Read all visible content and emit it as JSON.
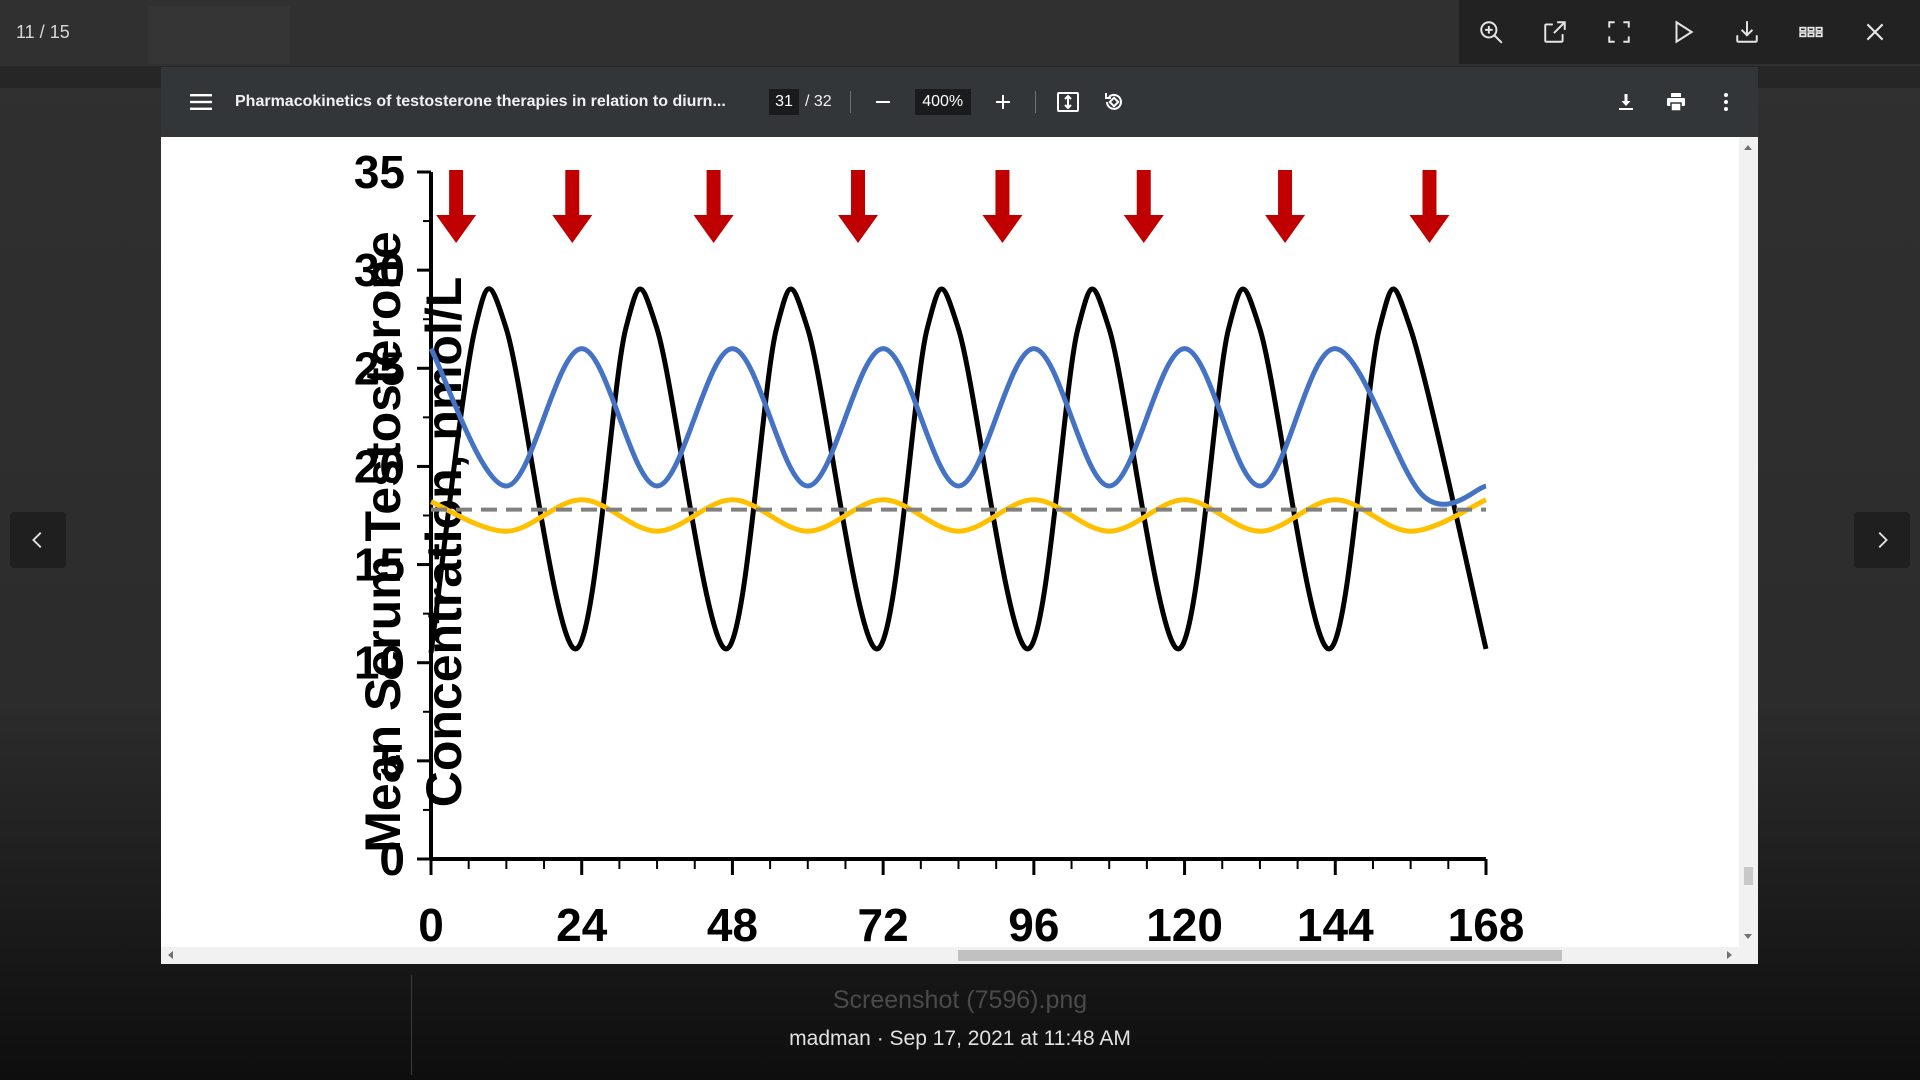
{
  "lightbox": {
    "counter": "11 / 15",
    "file_name": "Screenshot (7596).png",
    "meta": "madman · Sep 17, 2021 at 11:48 AM",
    "icons": [
      "zoom-in-icon",
      "open-external-icon",
      "fullscreen-icon",
      "slideshow-play-icon",
      "download-icon",
      "grid-icon",
      "close-icon"
    ]
  },
  "pdf": {
    "title": "Pharmacokinetics of testosterone therapies in relation to diurn...",
    "page_current": "31",
    "page_total": "/ 32",
    "zoom": "400%"
  },
  "chart_data": {
    "type": "line",
    "ylabel_line1": "Mean Serum Testosterone",
    "ylabel_line2": "Concentration, nmol/L",
    "ylim": [
      0,
      35
    ],
    "xlim": [
      0,
      168
    ],
    "y_ticks": [
      "0",
      "5",
      "10",
      "15",
      "20",
      "25",
      "30",
      "35"
    ],
    "x_ticks": [
      "0",
      "24",
      "48",
      "72",
      "96",
      "120",
      "144",
      "168"
    ],
    "dose_arrows_x": [
      4,
      22.5,
      45,
      68,
      91,
      113.5,
      136,
      159
    ],
    "arrow_color": "#c00000",
    "series": [
      {
        "color": "#000000",
        "x": [
          0,
          7,
          12,
          23,
          31,
          36,
          47,
          55,
          60,
          71,
          79,
          84,
          95,
          103,
          108,
          119,
          127,
          132,
          143,
          151,
          156,
          168
        ],
        "y": [
          10.5,
          27,
          27,
          10.7,
          27,
          27,
          10.7,
          27,
          27,
          10.7,
          27,
          27,
          10.7,
          27,
          27,
          10.7,
          27,
          27,
          10.7,
          27,
          27,
          10.7
        ]
      },
      {
        "color": "#4472c4",
        "x": [
          0,
          12,
          24,
          36,
          48,
          60,
          72,
          84,
          96,
          108,
          120,
          132,
          144,
          158,
          168
        ],
        "y": [
          26,
          19,
          26,
          19,
          26,
          19,
          26,
          19,
          26,
          19,
          26,
          19,
          26,
          18.5,
          19
        ]
      },
      {
        "color": "#ffc000",
        "x": [
          0,
          12,
          24,
          36,
          48,
          60,
          72,
          84,
          96,
          108,
          120,
          132,
          144,
          156,
          168
        ],
        "y": [
          18.2,
          16.7,
          18.3,
          16.7,
          18.3,
          16.7,
          18.3,
          16.7,
          18.3,
          16.7,
          18.3,
          16.7,
          18.3,
          16.7,
          18.3
        ]
      },
      {
        "color": "#808080",
        "dashed": true,
        "x": [
          0,
          168
        ],
        "y": [
          17.8,
          17.8
        ]
      }
    ]
  }
}
